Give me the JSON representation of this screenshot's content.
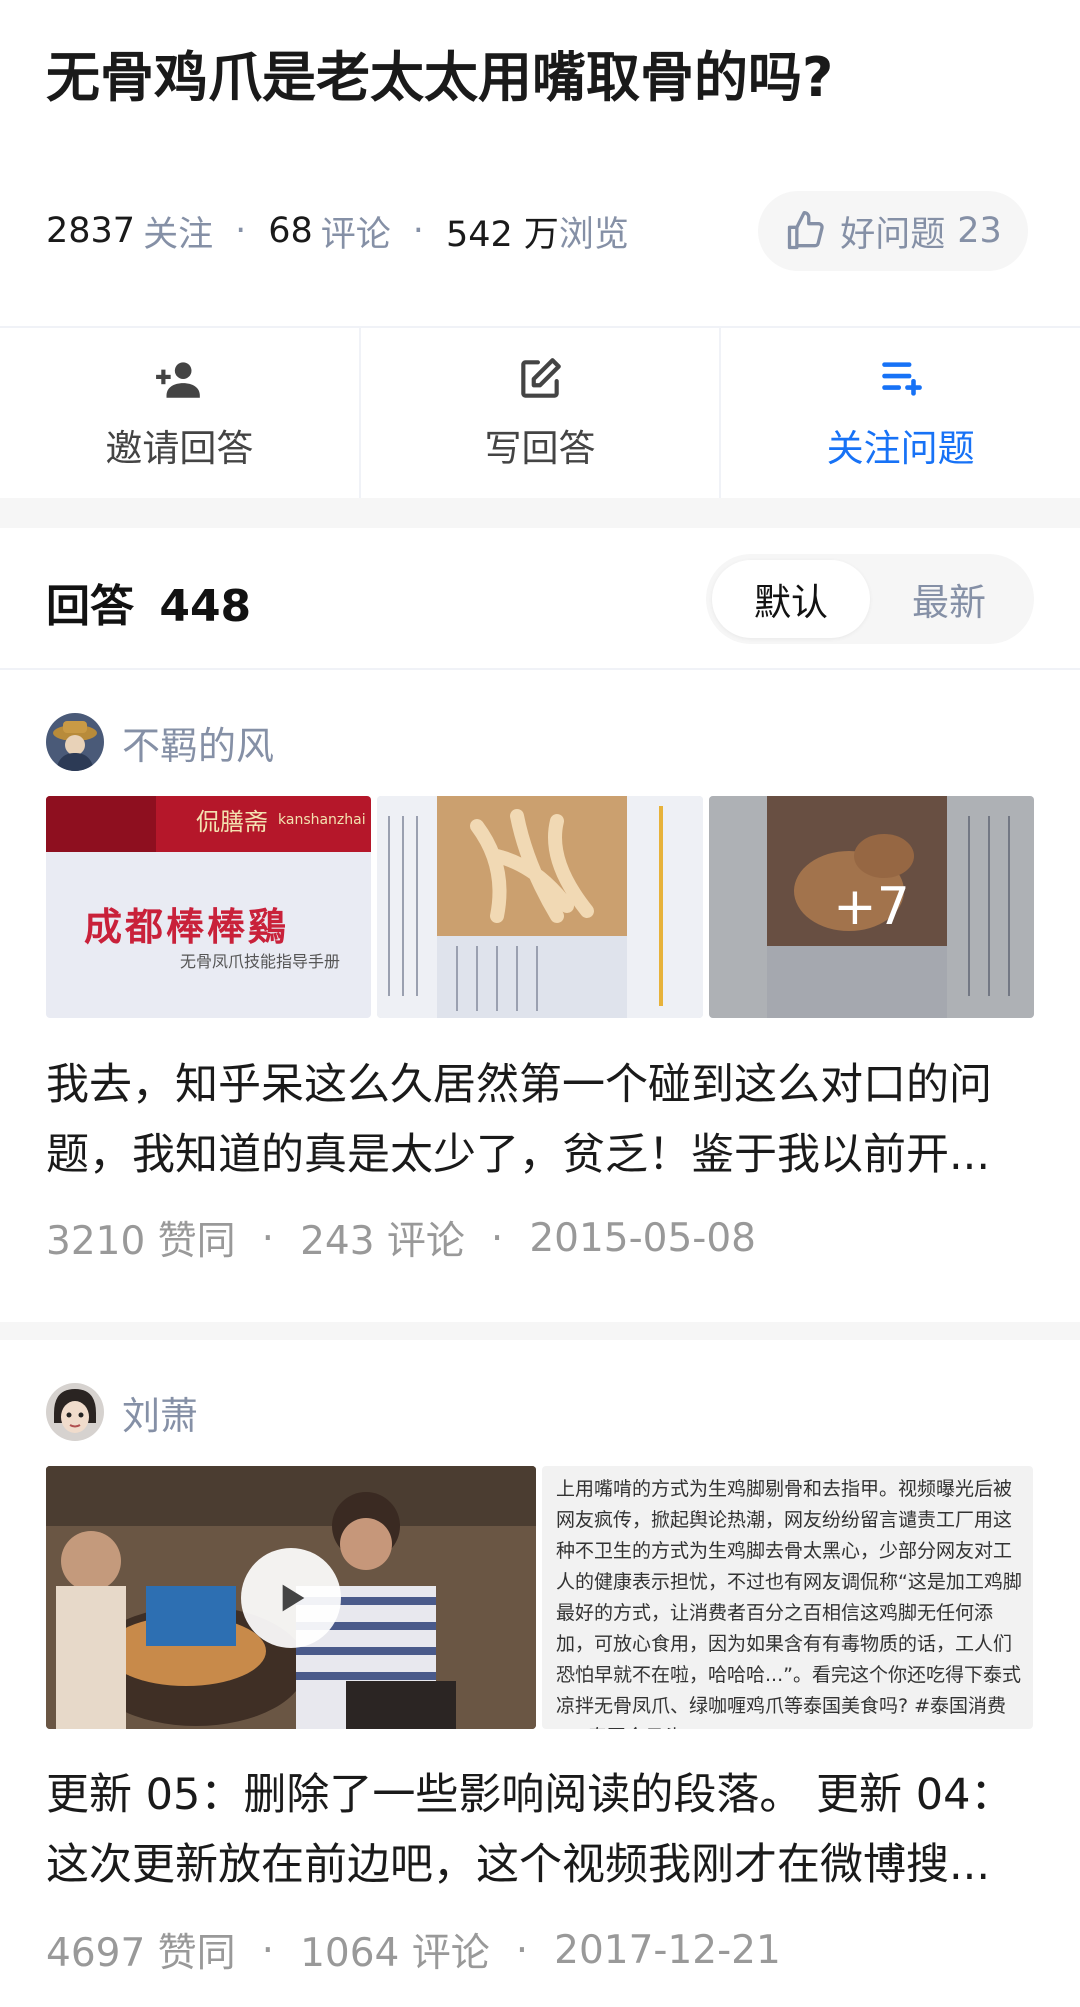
{
  "question": {
    "title": "无骨鸡爪是老太太用嘴取骨的吗?",
    "followers": "2837",
    "followers_label": "关注",
    "comments": "68",
    "comments_label": "评论",
    "views": "542 万",
    "views_label": "浏览",
    "good_question_label": "好问题",
    "good_question_count": "23"
  },
  "actions": {
    "invite_label": "邀请回答",
    "write_label": "写回答",
    "follow_label": "关注问题"
  },
  "answers": {
    "title": "回答",
    "count": "448",
    "sort_default": "默认",
    "sort_latest": "最新"
  },
  "answer_list": [
    {
      "author": "不羁的风",
      "thumb1_logo": "侃膳斋",
      "thumb1_logo_en": "kanshanzhai",
      "thumb1_main": "成都棒棒鷄",
      "thumb1_sub": "无骨凤爪技能指导手册",
      "more_count": "+7",
      "excerpt": "我去，知乎呆这么久居然第一个碰到这么对口的问题，我知道的真是太少了，贫乏！鉴于我以前开...",
      "likes": "3210 赞同",
      "comments": "243 评论",
      "date": "2015-05-08"
    },
    {
      "author": "刘萧",
      "video_caption": "上用嘴啃的方式为生鸡脚剔骨和去指甲。视频曝光后被网友疯传，掀起舆论热潮，网友纷纷留言谴责工厂用这种不卫生的方式为生鸡脚去骨太黑心，少部分网友对工人的健康表示担忧，不过也有网友调侃称“这是加工鸡脚最好的方式，让消费者百分之百相信这鸡脚无任何添加，可放心食用，因为如果含有有毒物质的话，工人们恐怕早就不在啦，哈哈哈...”。看完这个你还吃得下泰式凉拌无骨凤爪、绿咖喱鸡爪等泰国美食吗? #泰国消费##泰国今日头",
      "excerpt": "更新 05：删除了一些影响阅读的段落。 更新 04：这次更新放在前边吧，这个视频我刚才在微博搜...",
      "likes": "4697 赞同",
      "comments": "1064 评论",
      "date": "2017-12-21"
    }
  ],
  "colors": {
    "accent": "#1772f6",
    "muted": "#8590a6",
    "text": "#1a1a1a",
    "band": "#f6f6f6"
  },
  "icons": {
    "good_question": "thumbs-up-icon",
    "invite": "add-person-icon",
    "write": "edit-icon",
    "follow": "playlist-add-icon",
    "video": "play-icon"
  }
}
